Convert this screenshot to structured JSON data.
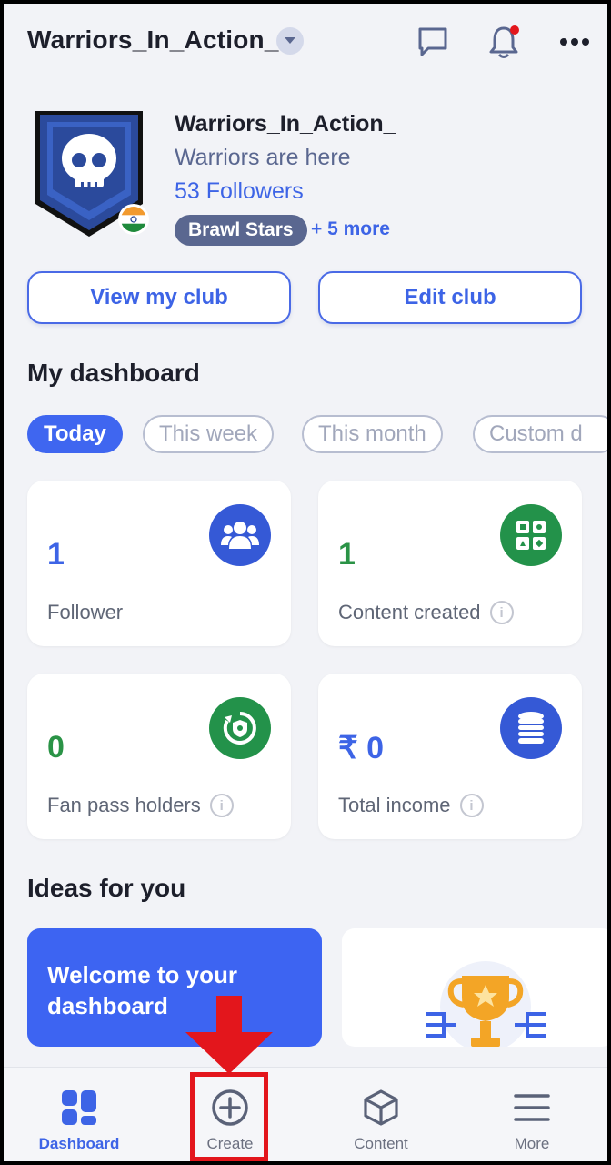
{
  "header": {
    "club_name": "Warriors_In_Action_"
  },
  "profile": {
    "name": "Warriors_In_Action_",
    "tagline": "Warriors are here",
    "followers": "53 Followers",
    "tag": "Brawl Stars",
    "more_tags": "+ 5 more"
  },
  "actions": {
    "view_club": "View my club",
    "edit_club": "Edit club"
  },
  "dashboard": {
    "title": "My dashboard",
    "filters": [
      "Today",
      "This week",
      "This month",
      "Custom d"
    ],
    "active_filter": "Today",
    "stats": [
      {
        "value": "1",
        "label": "Follower",
        "color": "#3d64e6",
        "icon": "people-icon",
        "badge_color": "#3559d6"
      },
      {
        "value": "1",
        "label": "Content created",
        "color": "#2a9346",
        "icon": "grid-icon",
        "badge_color": "#23924a"
      },
      {
        "value": "0",
        "label": "Fan pass holders",
        "color": "#2a9346",
        "icon": "pass-icon",
        "badge_color": "#23924a"
      },
      {
        "value": "₹ 0",
        "label": "Total income",
        "color": "#3d64e6",
        "icon": "coins-icon",
        "badge_color": "#3559d6"
      }
    ]
  },
  "ideas": {
    "title": "Ideas for you",
    "welcome_card": "Welcome to your dashboard"
  },
  "nav": {
    "items": [
      {
        "label": "Dashboard",
        "icon": "dashboard-icon"
      },
      {
        "label": "Create",
        "icon": "plus-circle-icon"
      },
      {
        "label": "Content",
        "icon": "cube-icon"
      },
      {
        "label": "More",
        "icon": "menu-icon"
      }
    ],
    "active": "Dashboard"
  },
  "colors": {
    "accent": "#3d64e6",
    "green": "#2a9346",
    "annotation": "#e3161c"
  }
}
